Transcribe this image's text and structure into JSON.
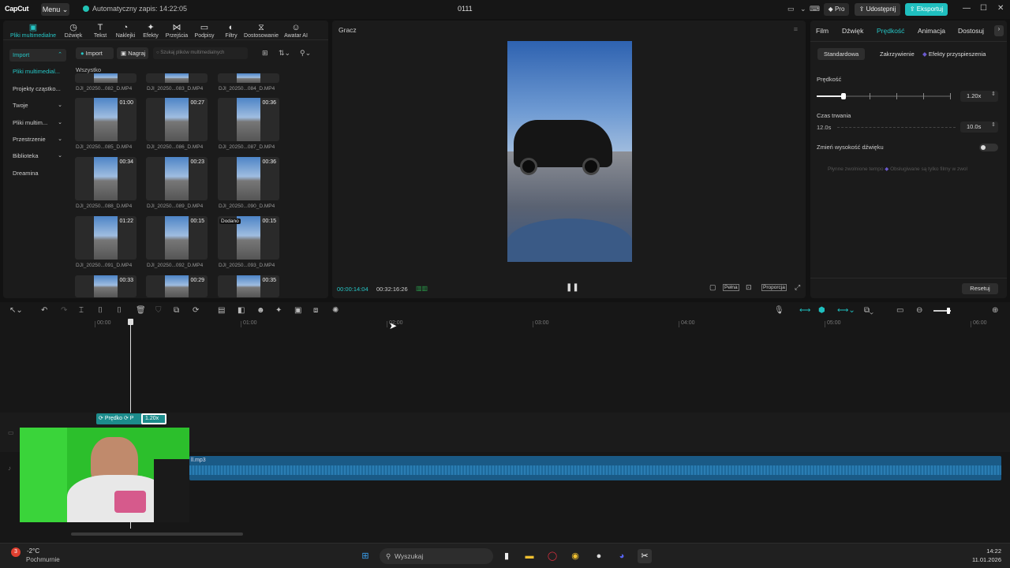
{
  "titlebar": {
    "app_name": "CapCut",
    "menu_label": "Menu",
    "autosave_text": "Automatyczny zapis: 14:22:05",
    "project_name": "0111",
    "pro_label": "Pro",
    "share_label": "Udostępnij",
    "export_label": "Eksportuj"
  },
  "media_tabs": [
    {
      "label": "Pliki multimedialne",
      "icon": "media-icon"
    },
    {
      "label": "Dźwięk",
      "icon": "audio-icon"
    },
    {
      "label": "Tekst",
      "icon": "text-icon"
    },
    {
      "label": "Naklejki",
      "icon": "sticker-icon"
    },
    {
      "label": "Efekty",
      "icon": "effects-icon"
    },
    {
      "label": "Przejścia",
      "icon": "transitions-icon"
    },
    {
      "label": "Podpisy",
      "icon": "captions-icon"
    },
    {
      "label": "Filtry",
      "icon": "filters-icon"
    },
    {
      "label": "Dostosowanie",
      "icon": "adjust-icon"
    },
    {
      "label": "Awatar AI",
      "icon": "avatar-icon"
    }
  ],
  "sidebar": [
    {
      "label": "Import"
    },
    {
      "label": "Pliki multimedial..."
    },
    {
      "label": "Projekty cząstko..."
    },
    {
      "label": "Twoje"
    },
    {
      "label": "Pliki multim..."
    },
    {
      "label": "Przestrzenie"
    },
    {
      "label": "Biblioteka"
    },
    {
      "label": "Dreamina"
    }
  ],
  "media_toolbar": {
    "import_label": "Import",
    "record_label": "Nagraj",
    "search_placeholder": "Szukaj plików multimedialnych",
    "section_label": "Wszystko"
  },
  "media_items": [
    {
      "name": "DJI_20250...082_D.MP4",
      "duration": ""
    },
    {
      "name": "DJI_20250...083_D.MP4",
      "duration": ""
    },
    {
      "name": "DJI_20250...084_D.MP4",
      "duration": ""
    },
    {
      "name": "DJI_20250...085_D.MP4",
      "duration": "01:00"
    },
    {
      "name": "DJI_20250...086_D.MP4",
      "duration": "00:27"
    },
    {
      "name": "DJI_20250...087_D.MP4",
      "duration": "00:36"
    },
    {
      "name": "DJI_20250...088_D.MP4",
      "duration": "00:34"
    },
    {
      "name": "DJI_20250...089_D.MP4",
      "duration": "00:23"
    },
    {
      "name": "DJI_20250...090_D.MP4",
      "duration": "00:36"
    },
    {
      "name": "DJI_20250...091_D.MP4",
      "duration": "01:22"
    },
    {
      "name": "DJI_20250...092_D.MP4",
      "duration": "00:15"
    },
    {
      "name": "DJI_20250...093_D.MP4",
      "duration": "00:15",
      "badge": "Dodano"
    },
    {
      "name": "",
      "duration": "00:33"
    },
    {
      "name": "",
      "duration": "00:29"
    },
    {
      "name": "",
      "duration": "00:35"
    }
  ],
  "player": {
    "title": "Gracz",
    "current_time": "00:00:14:04",
    "total_time": "00:32:16:26",
    "full_label": "Pełna",
    "ratio_label": "Proporcja"
  },
  "inspector": {
    "tabs": [
      "Film",
      "Dźwięk",
      "Prędkość",
      "Animacja",
      "Dostosuj"
    ],
    "subtabs": [
      "Standardowa",
      "Zakrzywienie",
      "Efekty przyspieszenia"
    ],
    "speed_label": "Prędkość",
    "speed_value": "1.20x",
    "speed_level": 0.2,
    "duration_label": "Czas trwania",
    "duration_original": "12.0s",
    "duration_value": "10.0s",
    "pitch_label": "Zmień wysokość dźwięku",
    "smooth_text": "Płynne zwolnione tempo",
    "smooth_note": "Obsługiwane są tylko filmy w zwol",
    "reset_label": "Resetuj"
  },
  "timeline": {
    "ruler": [
      "00:00",
      "01:00",
      "02:00",
      "03:00",
      "04:00",
      "05:00",
      "06:00"
    ],
    "clip_label_1": "Prędko",
    "clip_label_2": "P",
    "clip_speed": "1.20x",
    "audio_name": "ll.mp3"
  },
  "taskbar": {
    "temp": "-2°C",
    "weather": "Pochmurnie",
    "notification_count": "3",
    "search_placeholder": "Wyszukaj",
    "time": "14:22",
    "date": "11.01.2026"
  },
  "colors": {
    "accent": "#1fbfbf",
    "panel": "#1b1b1b",
    "bg": "#121212",
    "audio": "#1f6fa0"
  }
}
